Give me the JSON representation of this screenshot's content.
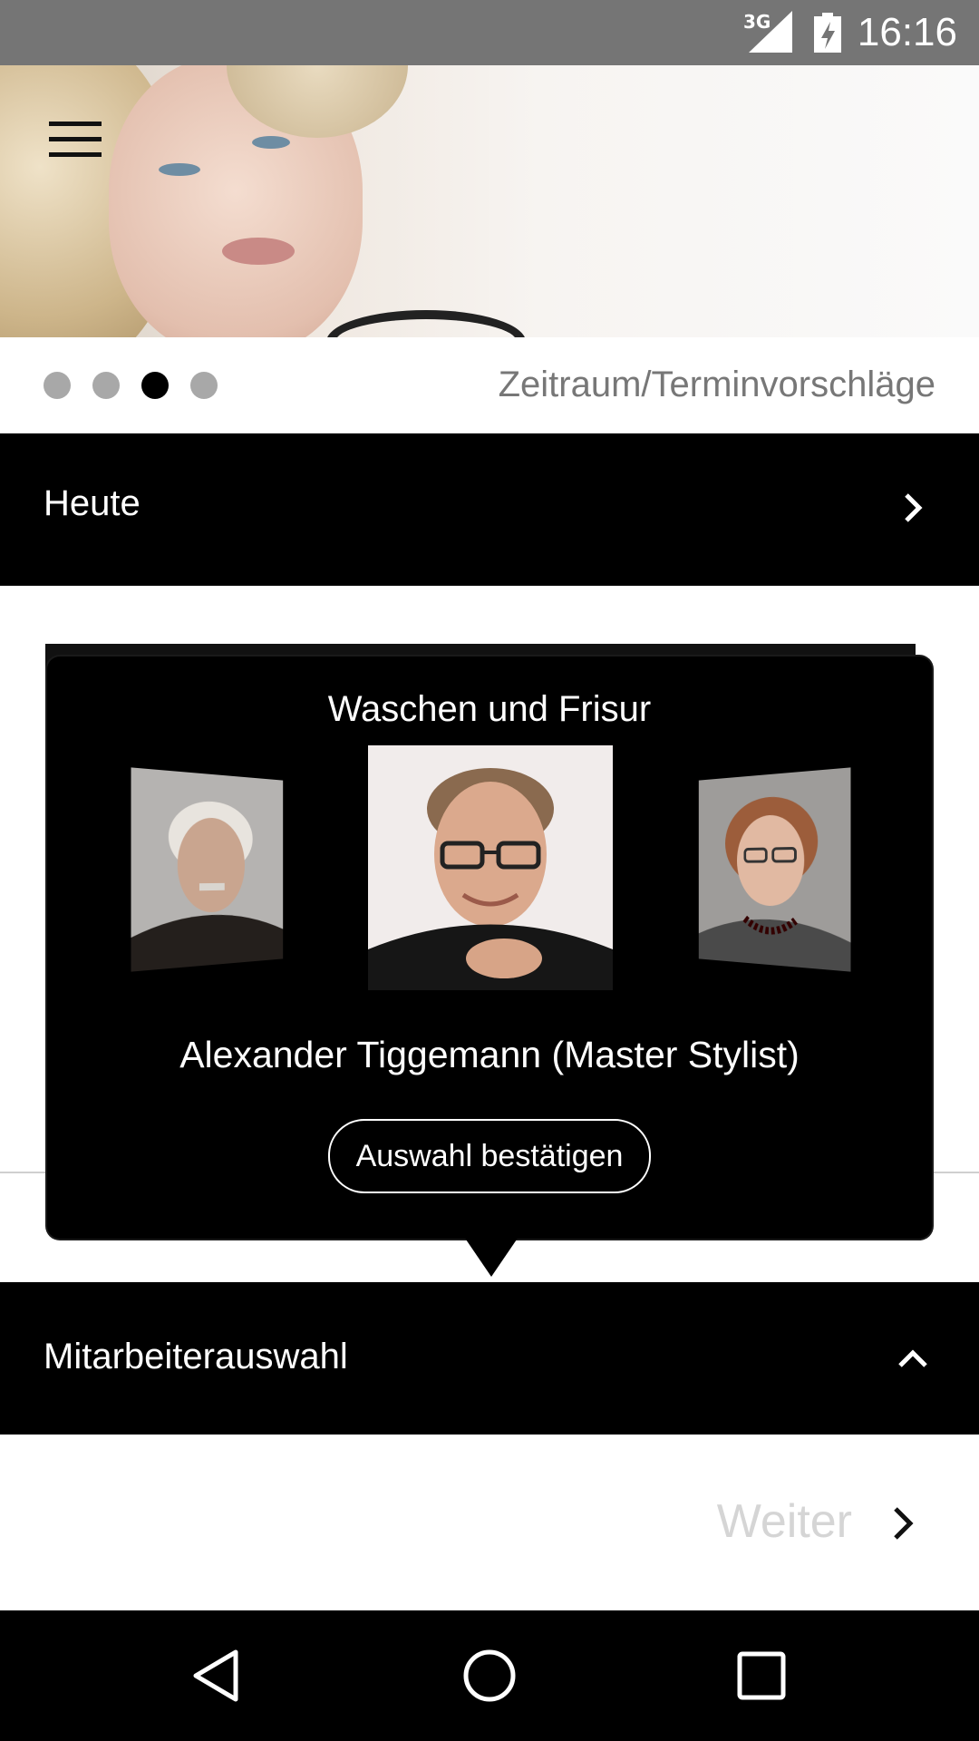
{
  "status_bar": {
    "network": "3G",
    "time": "16:16"
  },
  "header": {
    "menu_icon": "hamburger-icon"
  },
  "steps": {
    "count": 4,
    "active_index": 2,
    "title": "Zeitraum/Terminvorschläge"
  },
  "sections": {
    "today_label": "Heute",
    "staff_label": "Mitarbeiterauswahl"
  },
  "popup": {
    "title": "Waschen und Frisur",
    "selected_name": "Alexander Tiggemann (Master Stylist)",
    "confirm_label": "Auswahl bestätigen"
  },
  "footer": {
    "next_label": "Weiter"
  },
  "nav": {
    "back": "back-icon",
    "home": "home-icon",
    "recents": "recents-icon"
  }
}
